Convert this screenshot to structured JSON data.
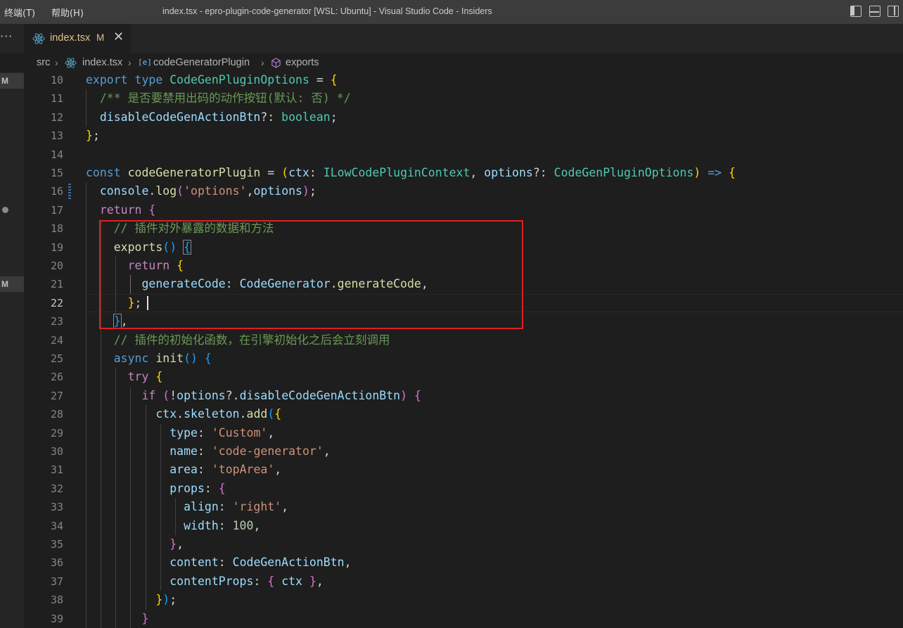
{
  "titlebar": {
    "menus": [
      "终端(T)",
      "帮助(H)"
    ],
    "title": "index.tsx - epro-plugin-code-generator [WSL: Ubuntu] - Visual Studio Code - Insiders",
    "layout_icons": [
      "toggle-primary-sidebar-icon",
      "toggle-panel-icon",
      "toggle-secondary-sidebar-icon"
    ]
  },
  "tabbar": {
    "overflow": "···",
    "tab": {
      "label": "index.tsx",
      "badge": "M",
      "close": "✕",
      "icon": "react-icon"
    }
  },
  "breadcrumb": {
    "items": [
      "src",
      "index.tsx",
      "codeGeneratorPlugin",
      "exports"
    ],
    "icons": [
      "react-icon",
      "variable-icon",
      "method-icon"
    ]
  },
  "gutter": {
    "scm_badges": [
      "M",
      "M"
    ]
  },
  "editor": {
    "active_line": 22,
    "lines": [
      {
        "n": 10,
        "tokens": [
          [
            "kw",
            "export "
          ],
          [
            "kw",
            "type "
          ],
          [
            "ty",
            "CodeGenPluginOptions"
          ],
          [
            "op",
            " = "
          ],
          [
            "b1",
            "{"
          ]
        ]
      },
      {
        "n": 11,
        "tokens": [
          [
            "cm",
            "  /** 是否要禁用出码的动作按钮(默认: 否) */"
          ]
        ]
      },
      {
        "n": 12,
        "tokens": [
          [
            "op",
            "  "
          ],
          [
            "va",
            "disableCodeGenActionBtn"
          ],
          [
            "op",
            "?: "
          ],
          [
            "ty",
            "boolean"
          ],
          [
            "op",
            ";"
          ]
        ]
      },
      {
        "n": 13,
        "tokens": [
          [
            "b1",
            "}"
          ],
          [
            "op",
            ";"
          ]
        ]
      },
      {
        "n": 14,
        "tokens": []
      },
      {
        "n": 15,
        "tokens": [
          [
            "kw",
            "const "
          ],
          [
            "fn",
            "codeGeneratorPlugin"
          ],
          [
            "op",
            " = "
          ],
          [
            "b1",
            "("
          ],
          [
            "va",
            "ctx"
          ],
          [
            "op",
            ": "
          ],
          [
            "ty",
            "ILowCodePluginContext"
          ],
          [
            "op",
            ", "
          ],
          [
            "va",
            "options"
          ],
          [
            "op",
            "?: "
          ],
          [
            "ty",
            "CodeGenPluginOptions"
          ],
          [
            "b1",
            ")"
          ],
          [
            "op",
            " "
          ],
          [
            "kw",
            "=>"
          ],
          [
            "op",
            " "
          ],
          [
            "b1",
            "{"
          ]
        ]
      },
      {
        "n": 16,
        "tokens": [
          [
            "op",
            "  "
          ],
          [
            "va",
            "console"
          ],
          [
            "op",
            "."
          ],
          [
            "fn",
            "log"
          ],
          [
            "b2",
            "("
          ],
          [
            "st",
            "'options'"
          ],
          [
            "op",
            ","
          ],
          [
            "va",
            "options"
          ],
          [
            "b2",
            ")"
          ],
          [
            "op",
            ";"
          ]
        ]
      },
      {
        "n": 17,
        "tokens": [
          [
            "op",
            "  "
          ],
          [
            "kc",
            "return "
          ],
          [
            "b2",
            "{"
          ]
        ]
      },
      {
        "n": 18,
        "tokens": [
          [
            "cm",
            "    // 插件对外暴露的数据和方法"
          ]
        ]
      },
      {
        "n": 19,
        "tokens": [
          [
            "op",
            "    "
          ],
          [
            "fn",
            "exports"
          ],
          [
            "b3",
            "()"
          ],
          [
            "op",
            " "
          ],
          [
            "b3",
            "{",
            "bmatch"
          ]
        ]
      },
      {
        "n": 20,
        "tokens": [
          [
            "op",
            "      "
          ],
          [
            "kc",
            "return "
          ],
          [
            "b1",
            "{"
          ]
        ]
      },
      {
        "n": 21,
        "tokens": [
          [
            "op",
            "        "
          ],
          [
            "va",
            "generateCode"
          ],
          [
            "op",
            ": "
          ],
          [
            "va",
            "CodeGenerator"
          ],
          [
            "op",
            "."
          ],
          [
            "fn",
            "generateCode"
          ],
          [
            "op",
            ","
          ]
        ]
      },
      {
        "n": 22,
        "tokens": [
          [
            "op",
            "      "
          ],
          [
            "b1",
            "}"
          ],
          [
            "op",
            ";"
          ]
        ]
      },
      {
        "n": 23,
        "tokens": [
          [
            "op",
            "    "
          ],
          [
            "b3",
            "}",
            "bmatch"
          ],
          [
            "op",
            ","
          ]
        ]
      },
      {
        "n": 24,
        "tokens": [
          [
            "cm",
            "    // 插件的初始化函数，在引擎初始化之后会立刻调用"
          ]
        ]
      },
      {
        "n": 25,
        "tokens": [
          [
            "op",
            "    "
          ],
          [
            "kw",
            "async "
          ],
          [
            "fn",
            "init"
          ],
          [
            "b3",
            "()"
          ],
          [
            "op",
            " "
          ],
          [
            "b3",
            "{"
          ]
        ]
      },
      {
        "n": 26,
        "tokens": [
          [
            "op",
            "      "
          ],
          [
            "kc",
            "try "
          ],
          [
            "b1",
            "{"
          ]
        ]
      },
      {
        "n": 27,
        "tokens": [
          [
            "op",
            "        "
          ],
          [
            "kc",
            "if "
          ],
          [
            "b2",
            "("
          ],
          [
            "op",
            "!"
          ],
          [
            "va",
            "options"
          ],
          [
            "op",
            "?."
          ],
          [
            "va",
            "disableCodeGenActionBtn"
          ],
          [
            "b2",
            ")"
          ],
          [
            "op",
            " "
          ],
          [
            "b2",
            "{"
          ]
        ]
      },
      {
        "n": 28,
        "tokens": [
          [
            "op",
            "          "
          ],
          [
            "va",
            "ctx"
          ],
          [
            "op",
            "."
          ],
          [
            "va",
            "skeleton"
          ],
          [
            "op",
            "."
          ],
          [
            "fn",
            "add"
          ],
          [
            "b3",
            "("
          ],
          [
            "b1",
            "{"
          ]
        ]
      },
      {
        "n": 29,
        "tokens": [
          [
            "op",
            "            "
          ],
          [
            "va",
            "type"
          ],
          [
            "op",
            ": "
          ],
          [
            "st",
            "'Custom'"
          ],
          [
            "op",
            ","
          ]
        ]
      },
      {
        "n": 30,
        "tokens": [
          [
            "op",
            "            "
          ],
          [
            "va",
            "name"
          ],
          [
            "op",
            ": "
          ],
          [
            "st",
            "'code-generator'"
          ],
          [
            "op",
            ","
          ]
        ]
      },
      {
        "n": 31,
        "tokens": [
          [
            "op",
            "            "
          ],
          [
            "va",
            "area"
          ],
          [
            "op",
            ": "
          ],
          [
            "st",
            "'topArea'"
          ],
          [
            "op",
            ","
          ]
        ]
      },
      {
        "n": 32,
        "tokens": [
          [
            "op",
            "            "
          ],
          [
            "va",
            "props"
          ],
          [
            "op",
            ": "
          ],
          [
            "b2",
            "{"
          ]
        ]
      },
      {
        "n": 33,
        "tokens": [
          [
            "op",
            "              "
          ],
          [
            "va",
            "align"
          ],
          [
            "op",
            ": "
          ],
          [
            "st",
            "'right'"
          ],
          [
            "op",
            ","
          ]
        ]
      },
      {
        "n": 34,
        "tokens": [
          [
            "op",
            "              "
          ],
          [
            "va",
            "width"
          ],
          [
            "op",
            ": "
          ],
          [
            "nu",
            "100"
          ],
          [
            "op",
            ","
          ]
        ]
      },
      {
        "n": 35,
        "tokens": [
          [
            "op",
            "            "
          ],
          [
            "b2",
            "}"
          ],
          [
            "op",
            ","
          ]
        ]
      },
      {
        "n": 36,
        "tokens": [
          [
            "op",
            "            "
          ],
          [
            "va",
            "content"
          ],
          [
            "op",
            ": "
          ],
          [
            "va",
            "CodeGenActionBtn"
          ],
          [
            "op",
            ","
          ]
        ]
      },
      {
        "n": 37,
        "tokens": [
          [
            "op",
            "            "
          ],
          [
            "va",
            "contentProps"
          ],
          [
            "op",
            ": "
          ],
          [
            "b2",
            "{"
          ],
          [
            "op",
            " "
          ],
          [
            "va",
            "ctx"
          ],
          [
            "op",
            " "
          ],
          [
            "b2",
            "}"
          ],
          [
            "op",
            ","
          ]
        ]
      },
      {
        "n": 38,
        "tokens": [
          [
            "op",
            "          "
          ],
          [
            "b1",
            "}"
          ],
          [
            "b3",
            ")"
          ],
          [
            "op",
            ";"
          ]
        ]
      },
      {
        "n": 39,
        "tokens": [
          [
            "op",
            "        "
          ],
          [
            "b2",
            "}"
          ]
        ]
      }
    ]
  },
  "annotation": {
    "color": "#e01f1f"
  }
}
